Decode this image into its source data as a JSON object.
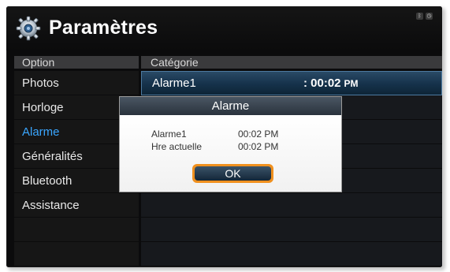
{
  "header": {
    "title": "Paramètres"
  },
  "columns": {
    "left": "Option",
    "right": "Catégorie"
  },
  "menu": {
    "items": [
      {
        "label": "Photos"
      },
      {
        "label": "Horloge"
      },
      {
        "label": "Alarme"
      },
      {
        "label": "Généralités"
      },
      {
        "label": "Bluetooth"
      },
      {
        "label": "Assistance"
      }
    ]
  },
  "category": {
    "label": "Alarme1",
    "time": ": 00:02",
    "ampm": "PM"
  },
  "dialog": {
    "title": "Alarme",
    "row1_label": "Alarme1",
    "row1_value": "00:02 PM",
    "row2_label": "Hre actuelle",
    "row2_value": "00:02 PM",
    "ok_label": "OK"
  },
  "colors": {
    "accent": "#3aa6ff",
    "focus": "#f0901e",
    "title_bar": "#2a333d"
  },
  "status_icons": [
    "bluetooth-icon",
    "clock-icon"
  ]
}
